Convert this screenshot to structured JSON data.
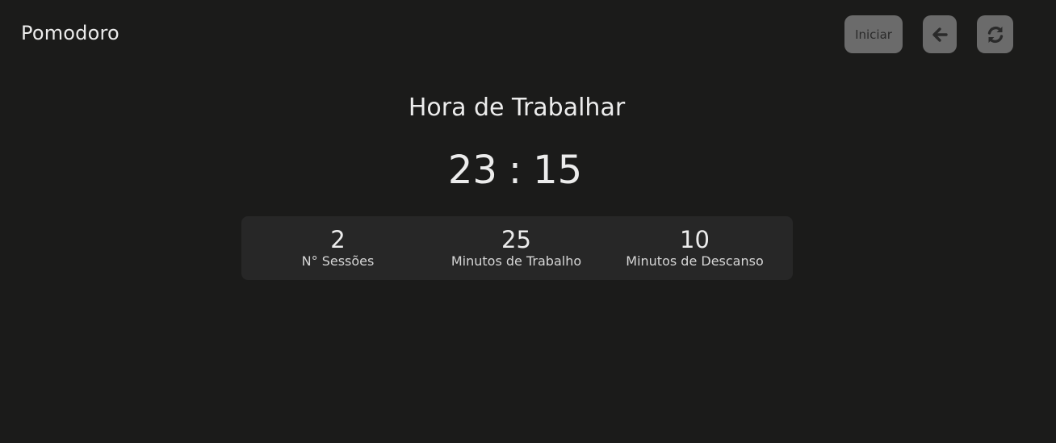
{
  "app": {
    "title": "Pomodoro"
  },
  "controls": {
    "start_label": "Iniciar",
    "back_icon": "arrow-left-icon",
    "reset_icon": "refresh-icon"
  },
  "timer": {
    "phase": "Hora de Trabalhar",
    "minutes": "23",
    "separator": ":",
    "seconds": "15"
  },
  "stats": [
    {
      "value": "2",
      "label": "N° Sessões"
    },
    {
      "value": "25",
      "label": "Minutos de Trabalho"
    },
    {
      "value": "10",
      "label": "Minutos de Descanso"
    }
  ],
  "colors": {
    "background": "#1b1b1a",
    "panel": "#272727",
    "button": "#6b6b6b",
    "text": "#ececec"
  }
}
